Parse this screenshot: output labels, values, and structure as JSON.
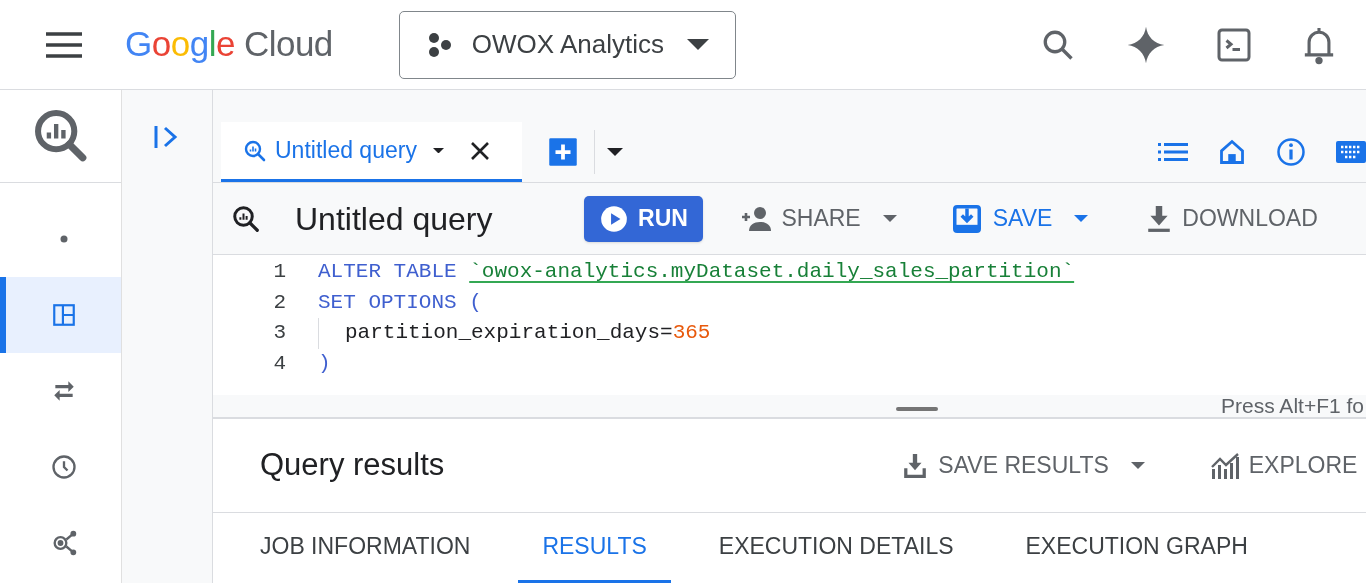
{
  "header": {
    "logo": {
      "brand": "Google",
      "product": "Cloud"
    },
    "project": "OWOX Analytics"
  },
  "rail_items": [
    {
      "kind": "dot",
      "selected": false
    },
    {
      "kind": "panels",
      "selected": true
    },
    {
      "kind": "transfer",
      "selected": false
    },
    {
      "kind": "history",
      "selected": false
    },
    {
      "kind": "graph",
      "selected": false
    }
  ],
  "tabs": [
    {
      "label": "Untitled query",
      "selected": true
    }
  ],
  "toolbar": {
    "title": "Untitled query",
    "run": "RUN",
    "share": "SHARE",
    "save": "SAVE",
    "download": "DOWNLOAD"
  },
  "editor": {
    "lines": [
      {
        "number": "1",
        "indent": false,
        "tokens": [
          {
            "kind": "keyword",
            "text": "ALTER TABLE"
          },
          {
            "kind": "string",
            "text": "`owox-analytics.myDataset.daily_sales_partition`"
          }
        ]
      },
      {
        "number": "2",
        "indent": false,
        "tokens": [
          {
            "kind": "keyword",
            "text": "SET OPTIONS ("
          }
        ]
      },
      {
        "number": "3",
        "indent": true,
        "tokens": [
          {
            "kind": "plain",
            "text": "partition_expiration_days="
          },
          {
            "kind": "number",
            "text": "365"
          }
        ]
      },
      {
        "number": "4",
        "indent": false,
        "tokens": [
          {
            "kind": "keyword",
            "text": ")"
          }
        ]
      }
    ],
    "hint": "Press Alt+F1 fo"
  },
  "results": {
    "title": "Query results",
    "save_results": "SAVE RESULTS",
    "explore": "EXPLORE",
    "tabs": [
      {
        "label": "JOB INFORMATION",
        "selected": false
      },
      {
        "label": "RESULTS",
        "selected": true
      },
      {
        "label": "EXECUTION DETAILS",
        "selected": false
      },
      {
        "label": "EXECUTION GRAPH",
        "selected": false
      }
    ]
  }
}
